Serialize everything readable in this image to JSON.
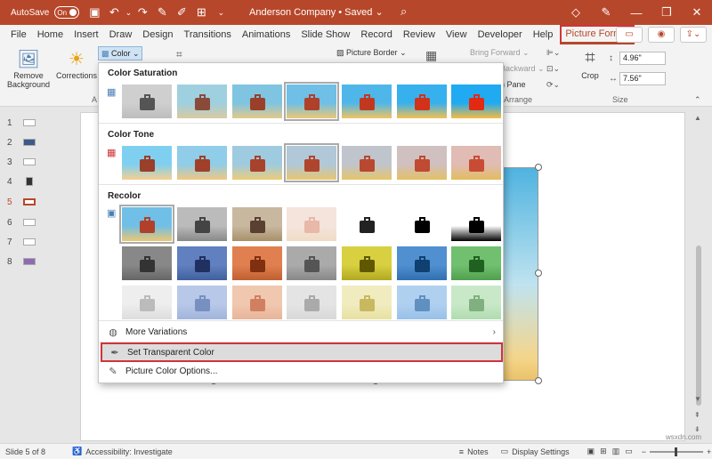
{
  "titlebar": {
    "autosave_label": "AutoSave",
    "autosave_state": "On",
    "doc_title": "Anderson Company • Saved",
    "doc_title_chevron": "⌄"
  },
  "menubar": {
    "tabs": [
      "File",
      "Home",
      "Insert",
      "Draw",
      "Design",
      "Transitions",
      "Animations",
      "Slide Show",
      "Record",
      "Review",
      "View",
      "Developer",
      "Help",
      "Picture Format"
    ],
    "active_tab": "Picture Format"
  },
  "ribbon": {
    "remove_background": "Remove Background",
    "corrections": "Corrections",
    "color": "Color",
    "picture_border": "Picture Border",
    "bring_forward": "Bring Forward",
    "send_backward": "Backward",
    "selection_pane": "n Pane",
    "arrange_label": "Arrange",
    "crop": "Crop",
    "height": "4.96\"",
    "width": "7.56\"",
    "size_label": "Size",
    "adjust_label_fragment": "A"
  },
  "slides": {
    "numbers": [
      "1",
      "2",
      "3",
      "4",
      "5",
      "6",
      "7",
      "8"
    ],
    "active": "5",
    "thumb_colors": [
      "#ffffff",
      "#3b5a8a",
      "#ffffff",
      "#ffffff",
      "#ffffff",
      "#ffffff",
      "#ffffff",
      "#8e6bb0"
    ]
  },
  "dropdown": {
    "saturation_title": "Color Saturation",
    "tone_title": "Color Tone",
    "recolor_title": "Recolor",
    "more_variations": "More Variations",
    "set_transparent": "Set Transparent Color",
    "picture_color_options": "Picture Color Options..."
  },
  "statusbar": {
    "slide_info": "Slide 5 of 8",
    "accessibility": "Accessibility: Investigate",
    "notes": "Notes",
    "display_settings": "Display Settings"
  },
  "watermark": "wsxdn.com",
  "colors": {
    "accent": "#b7472a",
    "highlight_border": "#d13438"
  }
}
